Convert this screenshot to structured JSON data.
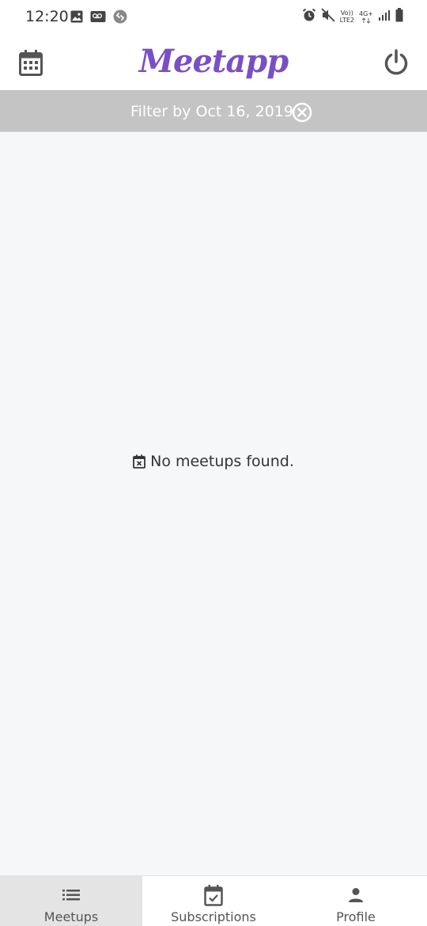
{
  "status_bar": {
    "time": "12:20",
    "net_line1": "Vo))",
    "net_line2": "LTE2",
    "net_type": "4G+",
    "icons": [
      "image-icon",
      "voicemail-icon",
      "shazam-icon",
      "alarm-icon",
      "mute-icon",
      "signal-icon",
      "battery-icon"
    ]
  },
  "header": {
    "logo": "Meetapp",
    "left_icon": "calendar-icon",
    "right_icon": "power-icon"
  },
  "filter": {
    "label": "Filter by Oct 16, 2019",
    "clear_icon": "close-circle-icon"
  },
  "empty_state": {
    "icon": "calendar-x-icon",
    "message": "No meetups found."
  },
  "bottom_nav": {
    "items": [
      {
        "label": "Meetups",
        "icon": "list-icon",
        "active": true
      },
      {
        "label": "Subscriptions",
        "icon": "calendar-check-icon",
        "active": false
      },
      {
        "label": "Profile",
        "icon": "person-icon",
        "active": false
      }
    ]
  },
  "colors": {
    "brand": "#7a4fc6",
    "filter_bar": "#c4c4c4",
    "background": "#f6f7f9",
    "active_tab": "#e4e4e4"
  }
}
